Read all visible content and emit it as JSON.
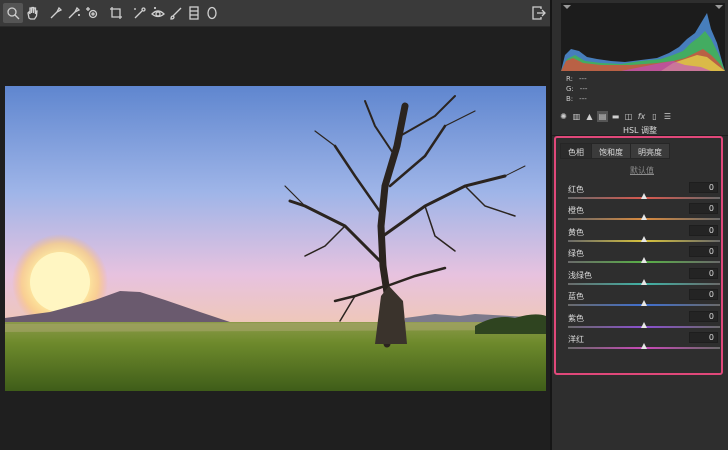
{
  "toolbar": {
    "tools": [
      {
        "name": "zoom-tool-icon",
        "glyph": "⚲"
      },
      {
        "name": "hand-tool-icon",
        "glyph": "✋"
      },
      {
        "name": "white-balance-icon",
        "glyph": "✒"
      },
      {
        "name": "color-sampler-icon",
        "glyph": "✒"
      },
      {
        "name": "target-adjust-icon",
        "glyph": "◎"
      },
      {
        "name": "crop-tool-icon",
        "glyph": "⌗"
      },
      {
        "name": "spot-removal-icon",
        "glyph": "✎"
      },
      {
        "name": "red-eye-icon",
        "glyph": "◉"
      },
      {
        "name": "brush-icon",
        "glyph": "✐"
      },
      {
        "name": "graduated-filter-icon",
        "glyph": "▦"
      },
      {
        "name": "radial-filter-icon",
        "glyph": "◯"
      }
    ],
    "export_icon": "export-icon"
  },
  "histogram": {
    "r_label": "R:",
    "r_value": "---",
    "g_label": "G:",
    "g_value": "---",
    "b_label": "B:",
    "b_value": "---"
  },
  "panel": {
    "title": "HSL 调整",
    "tabs": [
      "色相",
      "饱和度",
      "明亮度"
    ],
    "active_tab": 0,
    "defaults_link": "默认值",
    "sliders": [
      {
        "label": "红色",
        "value": "0",
        "color": "#d9584e"
      },
      {
        "label": "橙色",
        "value": "0",
        "color": "#d98a3e"
      },
      {
        "label": "黄色",
        "value": "0",
        "color": "#d8c33c"
      },
      {
        "label": "绿色",
        "value": "0",
        "color": "#58b046"
      },
      {
        "label": "浅绿色",
        "value": "0",
        "color": "#3fb3a6"
      },
      {
        "label": "蓝色",
        "value": "0",
        "color": "#3f6fd0"
      },
      {
        "label": "紫色",
        "value": "0",
        "color": "#8a4fd0"
      },
      {
        "label": "洋红",
        "value": "0",
        "color": "#c948b8"
      }
    ]
  },
  "colors": {
    "highlight_border": "#e0487a",
    "panel_bg": "#2e2e2e",
    "viewport_bg": "#1f1f1f"
  }
}
